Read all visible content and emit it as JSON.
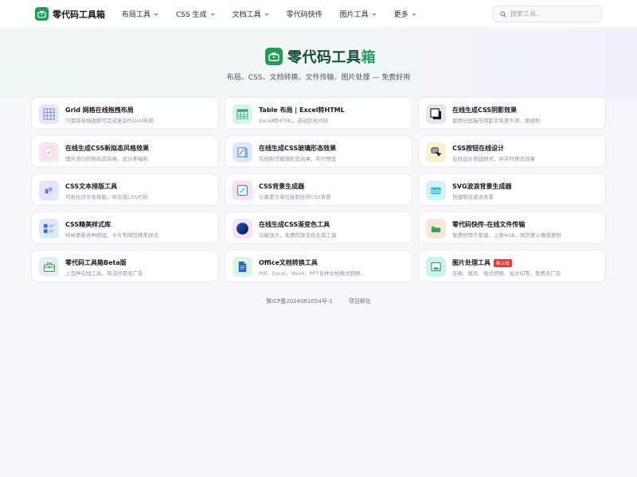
{
  "brand": {
    "name": "零代码工具箱"
  },
  "nav": {
    "items": [
      {
        "label": "布局工具",
        "has_dropdown": true
      },
      {
        "label": "CSS 生成",
        "has_dropdown": true
      },
      {
        "label": "文档工具",
        "has_dropdown": true
      },
      {
        "label": "零代码快传",
        "has_dropdown": false
      },
      {
        "label": "图片工具",
        "has_dropdown": true
      },
      {
        "label": "更多",
        "has_dropdown": true
      }
    ]
  },
  "search": {
    "placeholder": "搜索工具..."
  },
  "hero": {
    "title_main": "零代码工具",
    "title_accent": "箱",
    "subtitle": "布局、CSS、文档转换、文件传输、图片处理 — 免费好用"
  },
  "colors": {
    "brand": "#1f9d55",
    "badge": "#e53935"
  },
  "tools": [
    {
      "title": "Grid 网格在线拖拽布局",
      "desc": "只需简单拖拽即可完成复杂的Grid布局",
      "icon": "grid-icon",
      "icon_bg": "#e3e8fb"
    },
    {
      "title": "Table 布局 | Excel转HTML",
      "desc": "Excel转HTML，自动优化代码",
      "icon": "table-icon",
      "icon_bg": "#d8f5ea"
    },
    {
      "title": "在线生成CSS阴影效果",
      "desc": "使用分层箱形阴影实现更平滑、更锐利",
      "icon": "shadow-icon",
      "icon_bg": "#e5e7eb"
    },
    {
      "title": "在线生成CSS新拟态风格效果",
      "desc": "国外流行的新拟态风格，设计师福利",
      "icon": "neumorphism-icon",
      "icon_bg": "#fde4ef"
    },
    {
      "title": "在线生成CSS玻璃形态效果",
      "desc": "在线制作玻璃形态效果，实时预览",
      "icon": "glass-icon",
      "icon_bg": "#dbeafe"
    },
    {
      "title": "CSS按钮在线设计",
      "desc": "在线设计按钮样式，并实时预览效果",
      "icon": "button-icon",
      "icon_bg": "#fdf1c7"
    },
    {
      "title": "CSS文本排版工具",
      "desc": "可视化对文本排版，并生成CSS代码",
      "icon": "text-layout-icon",
      "icon_bg": "#e4e6fb"
    },
    {
      "title": "CSS背景生成器",
      "desc": "以像素为单位绘制任何CSS背景",
      "icon": "background-icon",
      "icon_bg": "#fde2ea"
    },
    {
      "title": "SVG波浪背景生成器",
      "desc": "快速制作波浪背景",
      "icon": "wave-icon",
      "icon_bg": "#cff5f6"
    },
    {
      "title": "CSS精美样式库",
      "desc": "持续更新各种按钮、卡片等网页精美样式",
      "icon": "style-library-icon",
      "icon_bg": "#dbeafe"
    },
    {
      "title": "在线生成CSS渐变色工具",
      "desc": "功能强大，免费的渐变色生成工具",
      "icon": "gradient-icon",
      "icon_bg": "#fbe3f3"
    },
    {
      "title": "零代码快传-在线文件传输",
      "desc": "免费好用不限速，上限4GB，网页更小兼容更好",
      "icon": "file-transfer-icon",
      "icon_bg": "#fde6d3"
    },
    {
      "title": "零代码工具箱Beta版",
      "desc": "上百种在线工具，简洁好用无广告",
      "icon": "toolbox-icon",
      "icon_bg": "#e6edf5"
    },
    {
      "title": "Office文档转换工具",
      "desc": "Pdf、Excel、Word、PPT各种文档格式转换...",
      "icon": "document-icon",
      "icon_bg": "#dcf5e6"
    },
    {
      "title": "图片处理工具",
      "desc": "压缩、裁剪、格式转换、加水印等，免费无广告",
      "icon": "image-icon",
      "icon_bg": "#cdf3ee",
      "badge": "新上线"
    }
  ],
  "footer": {
    "icp": "豫ICP备2024061054号-1",
    "incubation": "项目孵化"
  }
}
